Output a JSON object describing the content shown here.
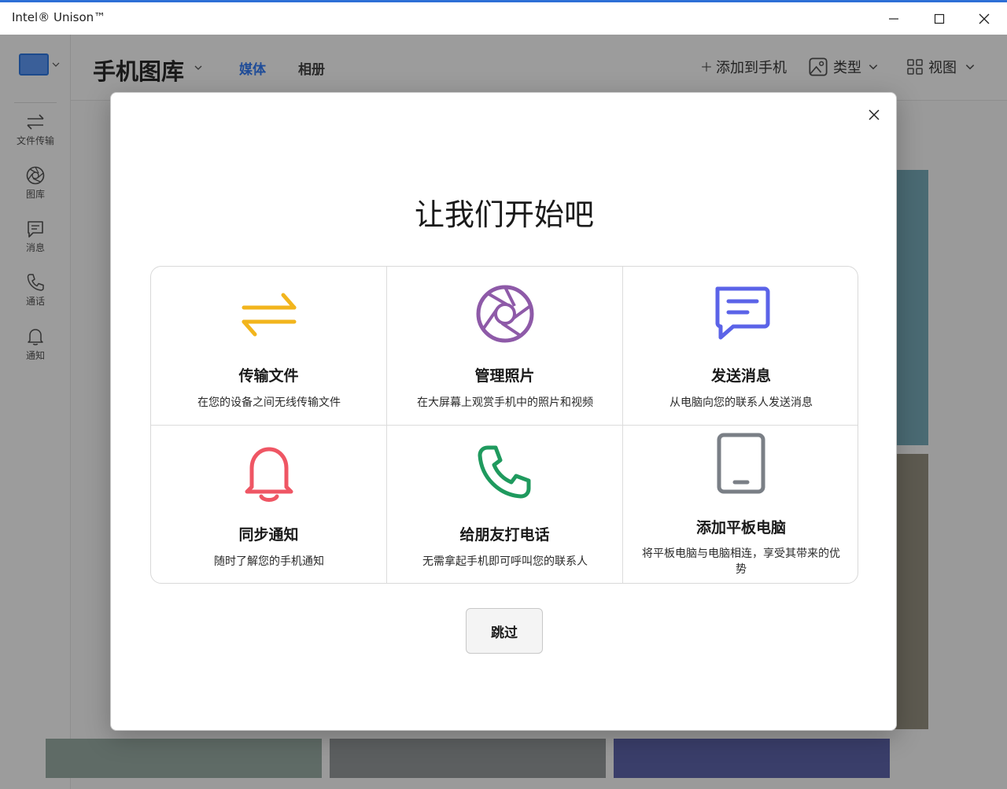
{
  "window": {
    "title": "Intel® Unison™"
  },
  "nav": {
    "items": [
      {
        "label": "文件传输",
        "icon": "transfer-icon"
      },
      {
        "label": "图库",
        "icon": "gallery-icon"
      },
      {
        "label": "消息",
        "icon": "message-icon"
      },
      {
        "label": "通话",
        "icon": "phone-icon"
      },
      {
        "label": "通知",
        "icon": "bell-icon"
      }
    ]
  },
  "header": {
    "title": "手机图库",
    "tabs": [
      {
        "label": "媒体",
        "selected": true
      },
      {
        "label": "相册",
        "selected": false
      }
    ],
    "add_to_phone": "添加到手机",
    "type_label": "类型",
    "view_label": "视图"
  },
  "dialog": {
    "title": "让我们开始吧",
    "features": [
      {
        "title": "传输文件",
        "desc": "在您的设备之间无线传输文件",
        "icon": "transfer-icon",
        "color": "#f2b51d"
      },
      {
        "title": "管理照片",
        "desc": "在大屏幕上观赏手机中的照片和视频",
        "icon": "aperture-icon",
        "color": "#8e5aa8"
      },
      {
        "title": "发送消息",
        "desc": "从电脑向您的联系人发送消息",
        "icon": "chat-icon",
        "color": "#5b63e8"
      },
      {
        "title": "同步通知",
        "desc": "随时了解您的手机通知",
        "icon": "bell-icon",
        "color": "#ef5664"
      },
      {
        "title": "给朋友打电话",
        "desc": "无需拿起手机即可呼叫您的联系人",
        "icon": "phone-icon",
        "color": "#1f9a5e"
      },
      {
        "title": "添加平板电脑",
        "desc": "将平板电脑与电脑相连，享受其带来的优势",
        "icon": "tablet-icon",
        "color": "#7a7f86"
      }
    ],
    "skip_label": "跳过"
  },
  "colors": {
    "accent": "#2d6fd6",
    "tab_selected": "#1f4c98"
  }
}
